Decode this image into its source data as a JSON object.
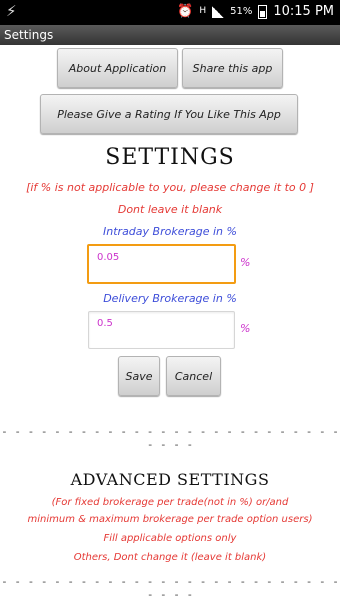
{
  "status_bar": {
    "battery": "51%",
    "time": "10:15 PM",
    "network": "H"
  },
  "app": {
    "title": "Settings"
  },
  "buttons": {
    "about": "About Application",
    "share": "Share this app",
    "rate": "Please Give a Rating If You Like This App",
    "save": "Save",
    "cancel": "Cancel"
  },
  "settings": {
    "heading": "SETTINGS",
    "note": "[if % is not applicable to you, please change it to 0 ]",
    "dont_blank": "Dont leave it blank",
    "intraday_label": "Intraday Brokerage in %",
    "intraday_value": "0.05",
    "delivery_label": "Delivery Brokerage in %",
    "delivery_value": "0.5",
    "percent_sign": "%"
  },
  "separator": "- - - - - - - - - - - - - - - - - - - - - - - - - - - - - -",
  "advanced": {
    "heading": "ADVANCED SETTINGS",
    "line1": "(For fixed brokerage per trade(not in %)  or/and",
    "line2": "minimum & maximum brokerage per trade option users)",
    "line3": "Fill applicable options only",
    "line4": "Others, Dont change it  (leave it blank)"
  }
}
